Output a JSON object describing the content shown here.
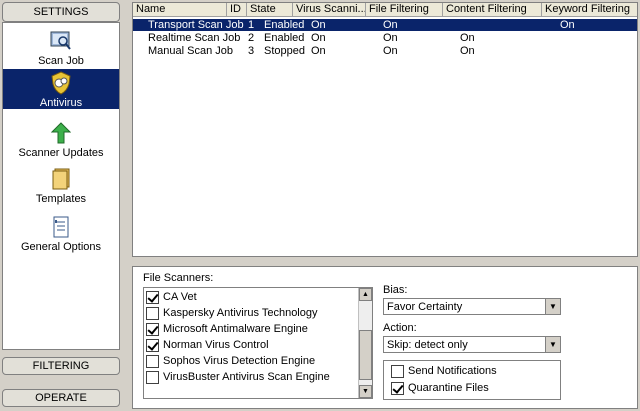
{
  "sidebar": {
    "header": "SETTINGS",
    "items": [
      {
        "label": "Scan Job",
        "icon": "scan-job-icon"
      },
      {
        "label": "Antivirus",
        "icon": "antivirus-shield-icon",
        "selected": true
      },
      {
        "label": "Scanner Updates",
        "icon": "up-arrow-icon"
      },
      {
        "label": "Templates",
        "icon": "templates-icon"
      },
      {
        "label": "General Options",
        "icon": "options-document-icon"
      }
    ],
    "filtering": "FILTERING",
    "operate": "OPERATE"
  },
  "table": {
    "columns": [
      "Name",
      "ID",
      "State",
      "Virus Scanni...",
      "File Filtering",
      "Content Filtering",
      "Keyword Filtering"
    ],
    "rows": [
      {
        "name": "Transport Scan Job",
        "id": "1",
        "state": "Enabled",
        "virus": "On",
        "file": "On",
        "content": "",
        "keyword": "On",
        "selected": true
      },
      {
        "name": "Realtime Scan Job",
        "id": "2",
        "state": "Enabled",
        "virus": "On",
        "file": "On",
        "content": "On",
        "keyword": ""
      },
      {
        "name": "Manual Scan Job",
        "id": "3",
        "state": "Stopped",
        "virus": "On",
        "file": "On",
        "content": "On",
        "keyword": ""
      }
    ]
  },
  "file_scanners": {
    "label": "File Scanners:",
    "items": [
      {
        "label": "CA Vet",
        "checked": true
      },
      {
        "label": "Kaspersky Antivirus Technology",
        "checked": false
      },
      {
        "label": "Microsoft Antimalware Engine",
        "checked": true
      },
      {
        "label": "Norman Virus Control",
        "checked": true
      },
      {
        "label": "Sophos Virus Detection Engine",
        "checked": false
      },
      {
        "label": "VirusBuster Antivirus Scan Engine",
        "checked": false
      }
    ]
  },
  "bias": {
    "label": "Bias:",
    "value": "Favor Certainty"
  },
  "action": {
    "label": "Action:",
    "value": "Skip: detect only"
  },
  "options": {
    "send_notifications": {
      "label": "Send Notifications",
      "checked": false
    },
    "quarantine_files": {
      "label": "Quarantine Files",
      "checked": true
    }
  },
  "colors": {
    "selection": "#0a246a",
    "window": "#d4d0c8"
  }
}
